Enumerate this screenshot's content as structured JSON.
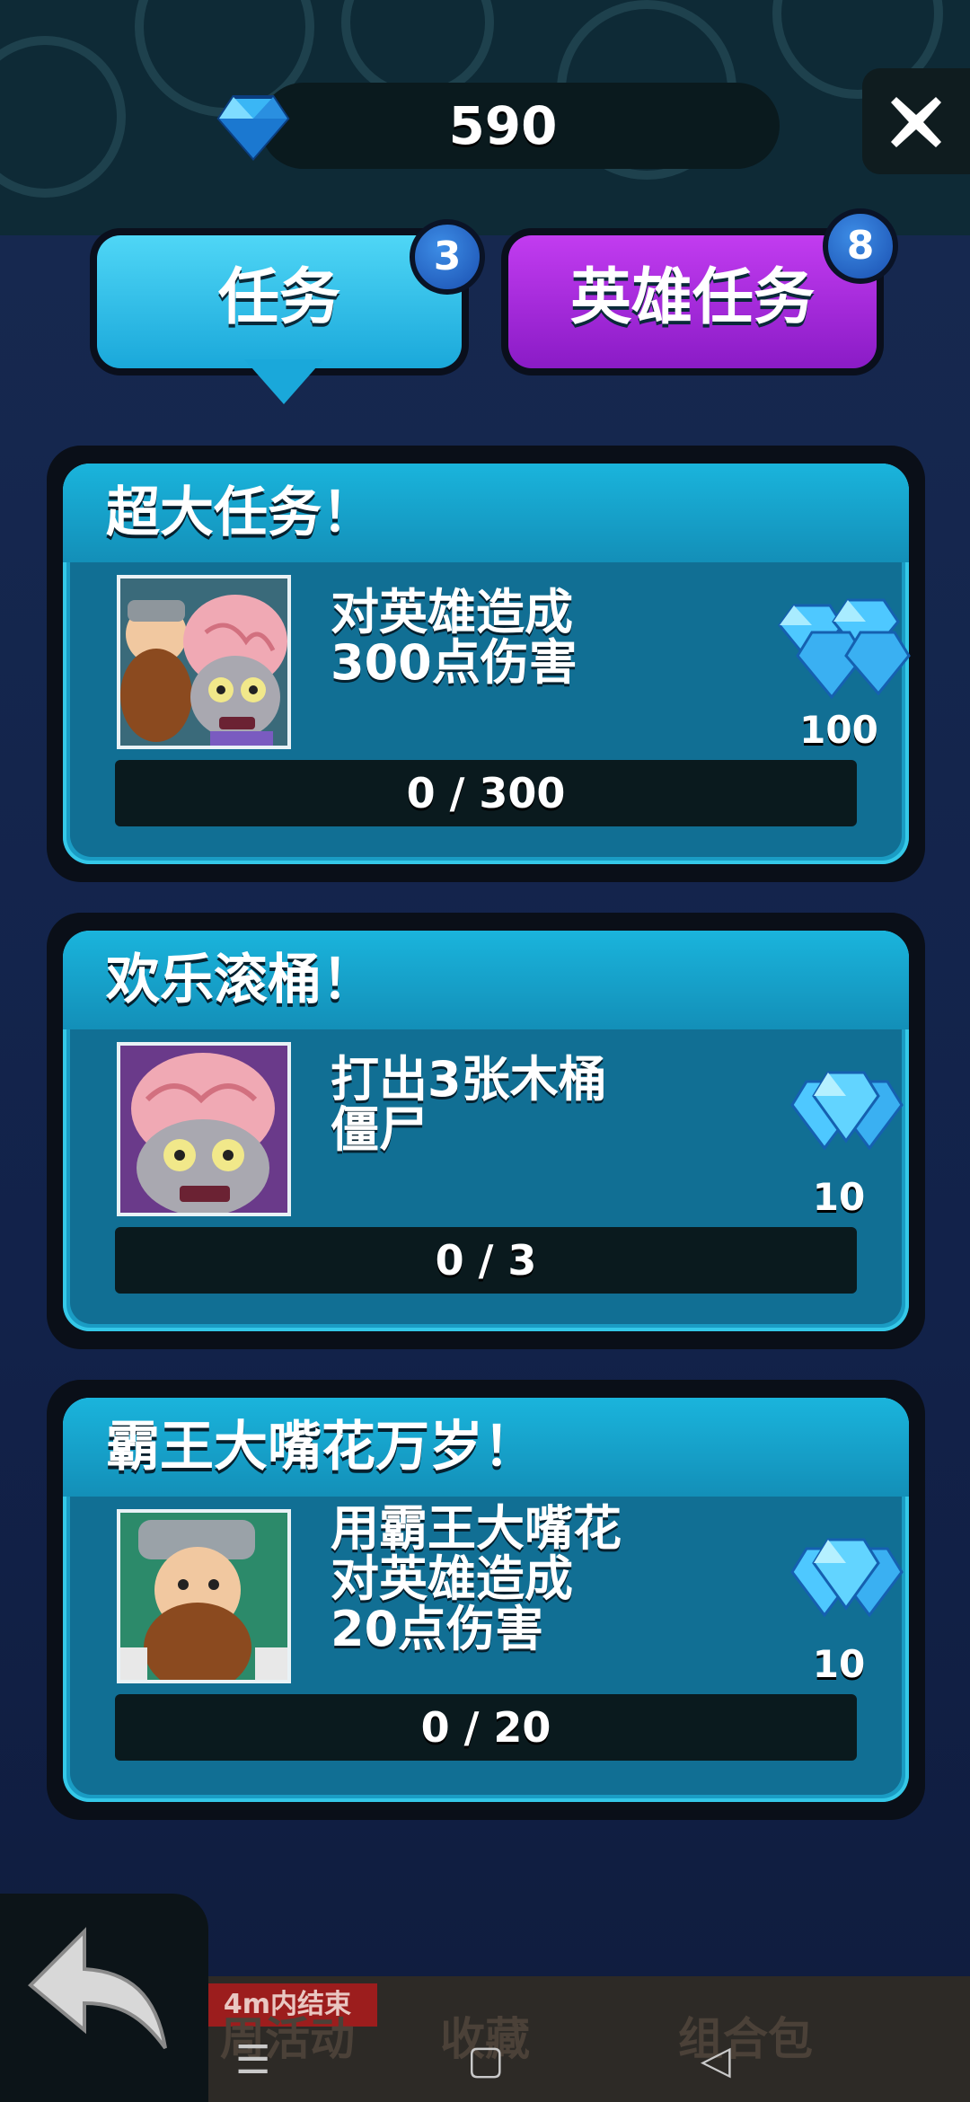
{
  "currency": {
    "gems": "590",
    "icon": "gem-icon"
  },
  "close_icon": "close-icon",
  "tabs": [
    {
      "label": "任务",
      "badge": "3",
      "active": true
    },
    {
      "label": "英雄任务",
      "badge": "8",
      "active": false
    }
  ],
  "quests": [
    {
      "title": "超大任务！",
      "desc_line1": "对英雄造成",
      "desc_line2": "300点伤害",
      "desc_line3": "",
      "reward": "100",
      "progress": "0 / 300"
    },
    {
      "title": "欢乐滚桶！",
      "desc_line1": "打出3张木桶",
      "desc_line2": "僵尸",
      "desc_line3": "",
      "reward": "10",
      "progress": "0 / 3"
    },
    {
      "title": "霸王大嘴花万岁！",
      "desc_line1": "用霸王大嘴花",
      "desc_line2": "对英雄造成",
      "desc_line3": "20点伤害",
      "reward": "10",
      "progress": "0 / 20"
    }
  ],
  "bottom_nav": {
    "ribbon": "4m内结束",
    "tab1": "周活动",
    "tab2": "收藏",
    "tab3": "组合包"
  },
  "back_icon": "back-arrow-icon",
  "colors": {
    "quest_tab": "#1aa8da",
    "hero_tab": "#8a1bc6",
    "card": "#1a9cc4",
    "badge": "#1a4fb0"
  }
}
